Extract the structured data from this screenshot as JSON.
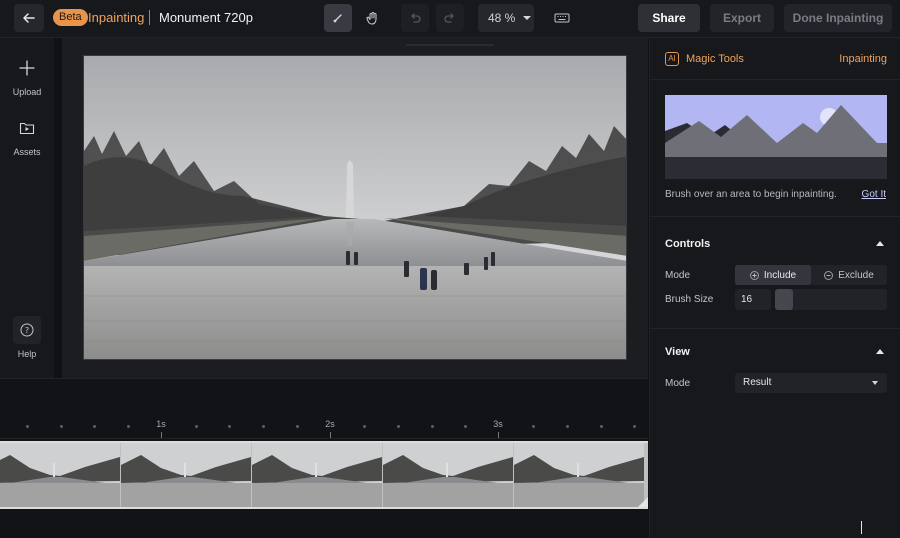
{
  "header": {
    "beta_label": "Beta",
    "app_name": "Inpainting",
    "project_name": "Monument 720p",
    "zoom": "48 %",
    "share_label": "Share",
    "export_label": "Export",
    "done_label": "Done Inpainting"
  },
  "rail": {
    "upload_label": "Upload",
    "assets_label": "Assets",
    "help_label": "Help"
  },
  "timeline": {
    "ticks": [
      "1s",
      "2s",
      "3s"
    ]
  },
  "panel": {
    "ai_badge": "AI",
    "title": "Magic Tools",
    "mode_name": "Inpainting",
    "hint": "Brush over an area to begin inpainting.",
    "got_it": "Got It",
    "controls": {
      "title": "Controls",
      "mode_label": "Mode",
      "include_label": "Include",
      "exclude_label": "Exclude",
      "selected": "Include",
      "brush_label": "Brush Size",
      "brush_value": "16"
    },
    "view": {
      "title": "View",
      "mode_label": "Mode",
      "mode_value": "Result"
    }
  },
  "colors": {
    "accent": "#e8944a",
    "background": "#101114",
    "panel": "#17181c"
  }
}
